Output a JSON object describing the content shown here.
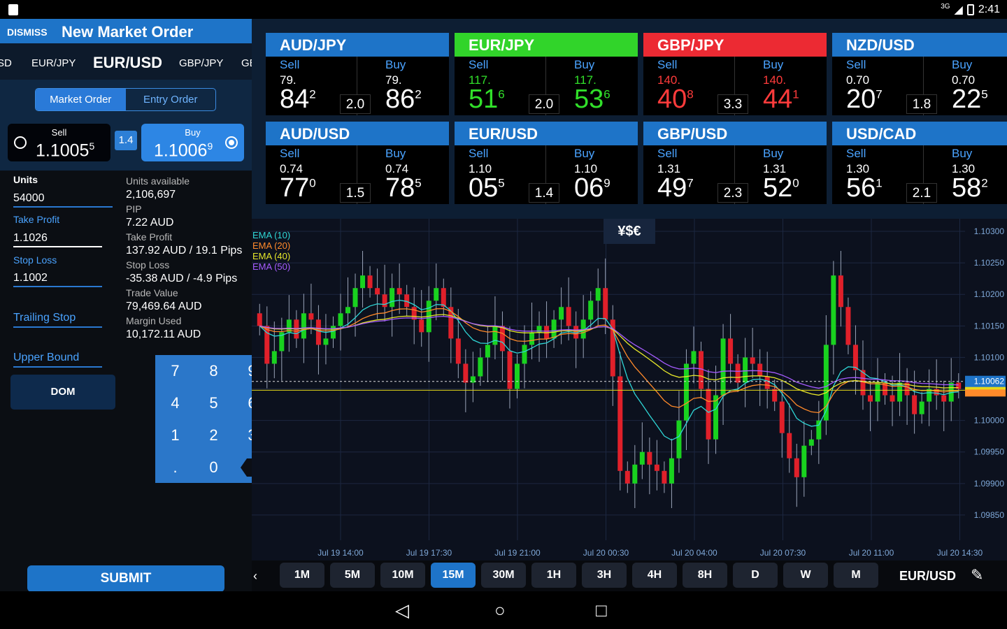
{
  "status": {
    "signal": "3G",
    "time": "2:41"
  },
  "header": {
    "dismiss": "DISMISS",
    "title": "New Market Order"
  },
  "pair_tabs": [
    "SD",
    "EUR/JPY",
    "EUR/USD",
    "GBP/JPY",
    "GE"
  ],
  "order_tabs": {
    "market": "Market Order",
    "entry": "Entry Order"
  },
  "sell": {
    "label": "Sell",
    "main": "1.1005",
    "pip": "5"
  },
  "buy": {
    "label": "Buy",
    "main": "1.1006",
    "pip": "9"
  },
  "spread": "1.4",
  "form": {
    "units_label": "Units",
    "units_value": "54000",
    "tp_label": "Take Profit",
    "tp_value": "1.1026",
    "sl_label": "Stop Loss",
    "sl_value": "1.1002",
    "trailing_label": "Trailing Stop",
    "upper_label": "Upper Bound",
    "dom": "DOM",
    "submit": "SUBMIT"
  },
  "info": [
    {
      "label": "Units available",
      "value": "2,106,697"
    },
    {
      "label": "PIP",
      "value": "7.22 AUD"
    },
    {
      "label": "Take Profit",
      "value": "137.92 AUD / 19.1 Pips"
    },
    {
      "label": "Stop Loss",
      "value": "-35.38 AUD / -4.9 Pips"
    },
    {
      "label": "Trade Value",
      "value": "79,469.64 AUD"
    },
    {
      "label": "Margin Used",
      "value": "10,172.11 AUD"
    }
  ],
  "keypad": {
    "keys": [
      "7",
      "8",
      "9",
      "4",
      "5",
      "6",
      "1",
      "2",
      "3",
      ".",
      "0"
    ],
    "backspace": "X"
  },
  "tiles": [
    {
      "pair": "AUD/JPY",
      "status": "neutral",
      "sell_label": "Sell",
      "buy_label": "Buy",
      "sell_small": "79.",
      "sell_big": "84",
      "sell_pip": "2",
      "buy_small": "79.",
      "buy_big": "86",
      "buy_pip": "2",
      "spread": "2.0"
    },
    {
      "pair": "EUR/JPY",
      "status": "up",
      "sell_label": "Sell",
      "buy_label": "Buy",
      "sell_small": "117.",
      "sell_big": "51",
      "sell_pip": "6",
      "buy_small": "117.",
      "buy_big": "53",
      "buy_pip": "6",
      "spread": "2.0"
    },
    {
      "pair": "GBP/JPY",
      "status": "down",
      "sell_label": "Sell",
      "buy_label": "Buy",
      "sell_small": "140.",
      "sell_big": "40",
      "sell_pip": "8",
      "buy_small": "140.",
      "buy_big": "44",
      "buy_pip": "1",
      "spread": "3.3"
    },
    {
      "pair": "NZD/USD",
      "status": "neutral",
      "sell_label": "Sell",
      "buy_label": "Buy",
      "sell_small": "0.70",
      "sell_big": "20",
      "sell_pip": "7",
      "buy_small": "0.70",
      "buy_big": "22",
      "buy_pip": "5",
      "spread": "1.8"
    },
    {
      "pair": "AUD/USD",
      "status": "neutral",
      "sell_label": "Sell",
      "buy_label": "Buy",
      "sell_small": "0.74",
      "sell_big": "77",
      "sell_pip": "0",
      "buy_small": "0.74",
      "buy_big": "78",
      "buy_pip": "5",
      "spread": "1.5"
    },
    {
      "pair": "EUR/USD",
      "status": "neutral",
      "sell_label": "Sell",
      "buy_label": "Buy",
      "sell_small": "1.10",
      "sell_big": "05",
      "sell_pip": "5",
      "buy_small": "1.10",
      "buy_big": "06",
      "buy_pip": "9",
      "spread": "1.4"
    },
    {
      "pair": "GBP/USD",
      "status": "neutral",
      "sell_label": "Sell",
      "buy_label": "Buy",
      "sell_small": "1.31",
      "sell_big": "49",
      "sell_pip": "7",
      "buy_small": "1.31",
      "buy_big": "52",
      "buy_pip": "0",
      "spread": "2.3"
    },
    {
      "pair": "USD/CAD",
      "status": "neutral",
      "sell_label": "Sell",
      "buy_label": "Buy",
      "sell_small": "1.30",
      "sell_big": "56",
      "sell_pip": "1",
      "buy_small": "1.30",
      "buy_big": "58",
      "buy_pip": "2",
      "spread": "2.1"
    }
  ],
  "chart_data": {
    "type": "candlestick",
    "currency_button": "¥$€",
    "legend": [
      {
        "name": "EMA (10)",
        "color": "#2fd6d6"
      },
      {
        "name": "EMA (20)",
        "color": "#ff8a2a"
      },
      {
        "name": "EMA (40)",
        "color": "#e6e62a"
      },
      {
        "name": "EMA (50)",
        "color": "#a65cff"
      }
    ],
    "y_ticks": [
      "1.10300",
      "1.10250",
      "1.10200",
      "1.10150",
      "1.10100",
      "1.10050",
      "1.10000",
      "1.09950",
      "1.09900",
      "1.09850"
    ],
    "y_range": [
      1.0981,
      1.1032
    ],
    "x_ticks": [
      "Jul 19 14:00",
      "Jul 19 17:30",
      "Jul 19 21:00",
      "Jul 20 00:30",
      "Jul 20 04:00",
      "Jul 20 07:30",
      "Jul 20 11:00",
      "Jul 20 14:30"
    ],
    "current_price": "1.10062",
    "current_price_value": 1.10062,
    "hidden_price_a": "1.10035",
    "hidden_price_b": "1.10043",
    "reference_line_value": 1.10048,
    "closes": [
      1.1015,
      1.1009,
      1.1011,
      1.1014,
      1.1016,
      1.1013,
      1.1017,
      1.1016,
      1.1012,
      1.1013,
      1.1015,
      1.1017,
      1.1018,
      1.1021,
      1.1023,
      1.1021,
      1.102,
      1.1018,
      1.1021,
      1.102,
      1.1018,
      1.1016,
      1.1014,
      1.1019,
      1.1021,
      1.1018,
      1.1013,
      1.1009,
      1.1006,
      1.1007,
      1.101,
      1.1012,
      1.1015,
      1.1011,
      1.1005,
      1.1009,
      1.1012,
      1.1014,
      1.1015,
      1.1013,
      1.1016,
      1.1018,
      1.1015,
      1.1013,
      1.1016,
      1.1019,
      1.1021,
      1.1016,
      1.1007,
      1.0992,
      1.099,
      1.0993,
      1.0995,
      1.0993,
      1.0992,
      1.099,
      1.0994,
      1.1,
      1.1009,
      1.1011,
      1.1005,
      1.0997,
      1.1004,
      1.1013,
      1.1009,
      1.1006,
      1.101,
      1.1009,
      1.1007,
      1.1005,
      1.1003,
      1.0998,
      1.0994,
      1.0991,
      1.0996,
      1.0997,
      1.1,
      1.1012,
      1.1023,
      1.1018,
      1.1012,
      1.1008,
      1.1004,
      1.1003,
      1.1006,
      1.1004,
      1.1003,
      1.1006,
      1.1004,
      1.1001,
      1.1003,
      1.1005,
      1.1004,
      1.1003,
      1.1006,
      1.1005
    ]
  },
  "timeframes": [
    "1M",
    "5M",
    "10M",
    "15M",
    "30M",
    "1H",
    "3H",
    "4H",
    "8H",
    "D",
    "W",
    "M"
  ],
  "active_timeframe": "15M",
  "chart_pair": "EUR/USD"
}
